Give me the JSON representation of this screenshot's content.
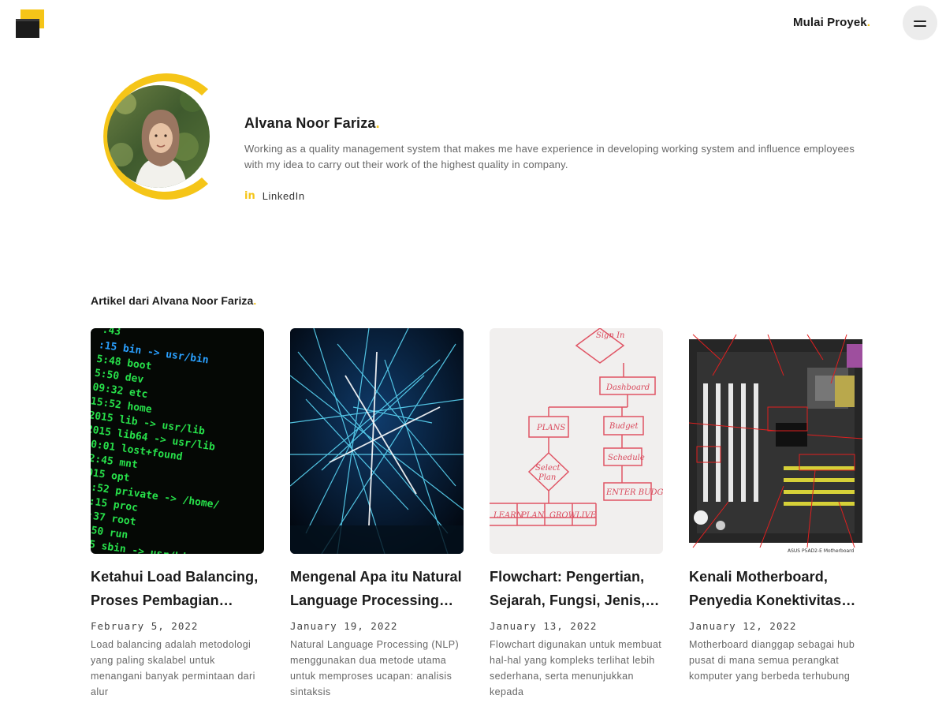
{
  "header": {
    "logo_icon": "stacked-blocks-logo",
    "cta_label": "Mulai Proyek",
    "cta_dot": ".",
    "menu_icon": "hamburger-icon",
    "accent_color": "#f5c518"
  },
  "author": {
    "name": "Alvana Noor Fariza",
    "name_dot": ".",
    "bio": "Working as a quality management system that makes me have experience in developing working system and influence employees with my idea to carry out their work of the highest quality in company.",
    "social": {
      "icon": "linkedin-icon",
      "icon_text": "in",
      "label": "LinkedIn"
    }
  },
  "articles_section": {
    "title": "Artikel dari Alvana Noor Fariza",
    "title_dot": ".",
    "cards": [
      {
        "thumb": "terminal-code-image",
        "title": "Ketahui Load Balancing, Proses Pembagian Beban Jaringan",
        "date": "February 5, 2022",
        "excerpt": "Load balancing adalah metodologi yang paling skalabel untuk menangani banyak permintaan dari alur"
      },
      {
        "thumb": "network-lines-image",
        "title": "Mengenal Apa itu Natural Language Processing (NLP)",
        "date": "January 19, 2022",
        "excerpt": "Natural Language Processing (NLP) menggunakan dua metode utama untuk memproses ucapan: analisis sintaksis"
      },
      {
        "thumb": "whiteboard-flowchart-image",
        "title": "Flowchart: Pengertian, Sejarah, Fungsi, Jenis, dan Simbolnya",
        "date": "January 13, 2022",
        "excerpt": "Flowchart digunakan untuk membuat hal-hal yang kompleks terlihat lebih sederhana, serta menunjukkan kepada"
      },
      {
        "thumb": "motherboard-diagram-image",
        "title": "Kenali Motherboard, Penyedia Konektivitas Komputer",
        "date": "January 12, 2022",
        "excerpt": "Motherboard dianggap sebagai hub pusat di mana semua perangkat komputer yang berbeda terhubung"
      }
    ]
  }
}
